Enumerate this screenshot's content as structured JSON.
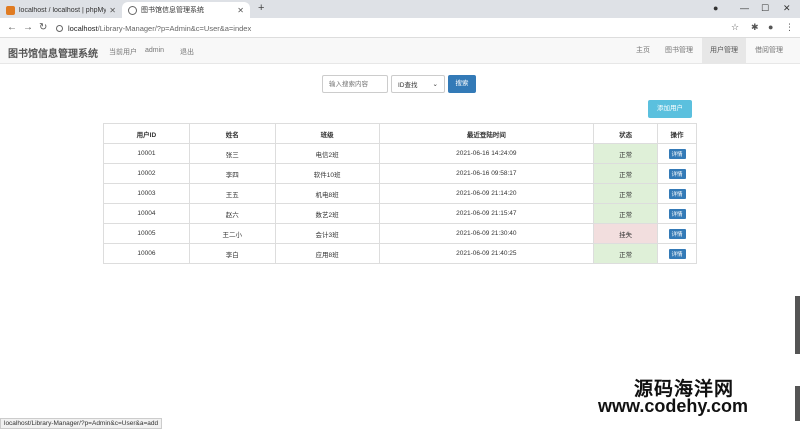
{
  "browser": {
    "tabs": [
      {
        "label": "localhost / localhost | phpMy..."
      },
      {
        "label": "图书馆信息管理系统"
      }
    ],
    "new_tab": "+",
    "url_host": "localhost",
    "url_path": "/Library-Manager/?p=Admin&c=User&a=index"
  },
  "navbar": {
    "brand": "图书馆信息管理系统",
    "current_user_label": "当前用户",
    "current_user": "admin",
    "logout": "退出",
    "menu": [
      "主页",
      "图书管理",
      "用户管理",
      "借阅管理"
    ]
  },
  "search": {
    "placeholder": "输入搜索内容",
    "select_value": "ID查找",
    "button": "搜索"
  },
  "add_user_button": "添加用户",
  "table": {
    "headers": [
      "用户ID",
      "姓名",
      "班级",
      "最近登陆时间",
      "状态",
      "操作"
    ],
    "rows": [
      {
        "id": "10001",
        "name": "张三",
        "class": "电信2班",
        "time": "2021-06-16 14:24:09",
        "status": "正常",
        "action": "详情"
      },
      {
        "id": "10002",
        "name": "李四",
        "class": "软件10班",
        "time": "2021-06-16 09:58:17",
        "status": "正常",
        "action": "详情"
      },
      {
        "id": "10003",
        "name": "王五",
        "class": "机电8班",
        "time": "2021-06-09 21:14:20",
        "status": "正常",
        "action": "详情"
      },
      {
        "id": "10004",
        "name": "赵六",
        "class": "数艺2班",
        "time": "2021-06-09 21:15:47",
        "status": "正常",
        "action": "详情"
      },
      {
        "id": "10005",
        "name": "王二小",
        "class": "会计3班",
        "time": "2021-06-09 21:30:40",
        "status": "挂失",
        "action": "详情"
      },
      {
        "id": "10006",
        "name": "李白",
        "class": "应用8班",
        "time": "2021-06-09 21:40:25",
        "status": "正常",
        "action": "详情"
      }
    ]
  },
  "statusbar": "localhost/Library-Manager/?p=Admin&c=User&a=add",
  "watermark": {
    "line1": "源码海洋网",
    "line2": "www.codehy.com"
  },
  "colors": {
    "primary": "#337ab7",
    "info": "#5bc0de",
    "success_bg": "#dff0d8",
    "danger_bg": "#f2dede"
  }
}
